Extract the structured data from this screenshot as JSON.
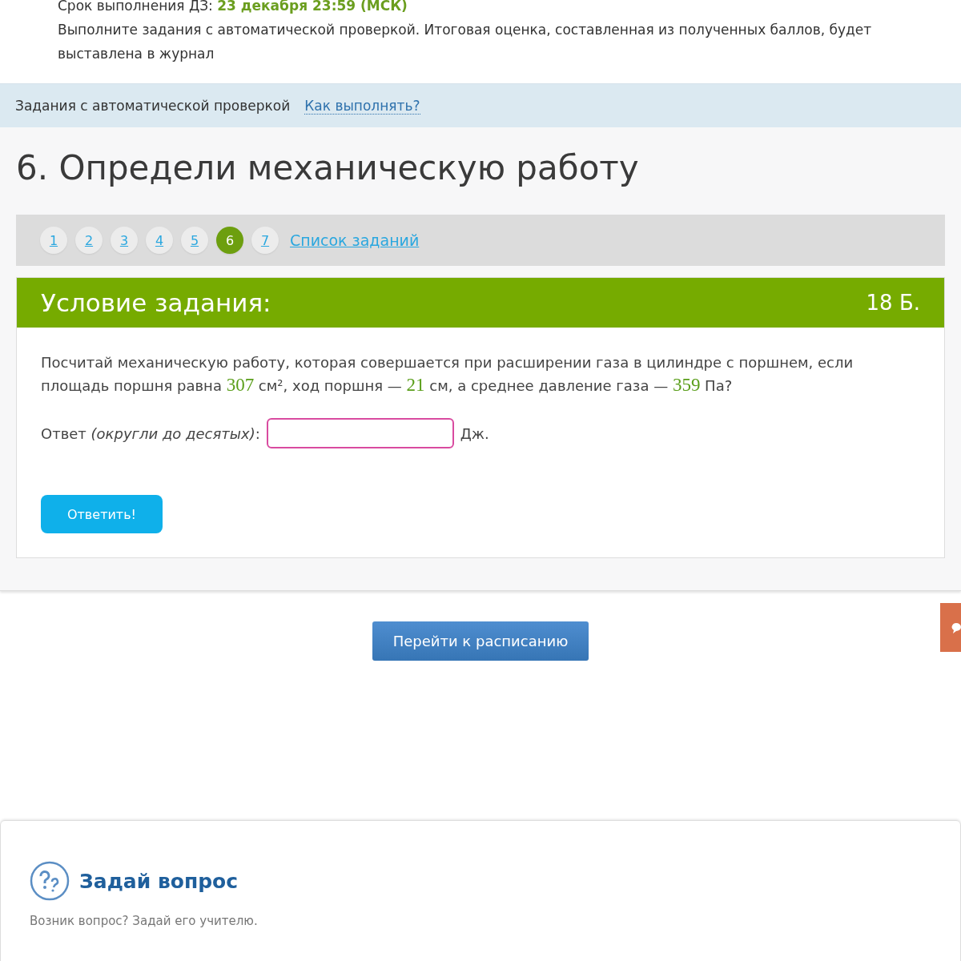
{
  "homework": {
    "deadline_label": "Срок выполнения ДЗ:",
    "deadline_value": "23 декабря 23:59 (МСК)",
    "description": "Выполните задания с автоматической проверкой. Итоговая оценка, составленная из полученных баллов, будет выставлена в журнал"
  },
  "section_bar": {
    "title": "Задания с автоматической проверкой",
    "help_link": "Как выполнять?"
  },
  "task_title": "6. Определи механическую работу",
  "task_nav": {
    "items": [
      {
        "label": "1",
        "selected": false
      },
      {
        "label": "2",
        "selected": false
      },
      {
        "label": "3",
        "selected": false
      },
      {
        "label": "4",
        "selected": false
      },
      {
        "label": "5",
        "selected": false
      },
      {
        "label": "6",
        "selected": true
      },
      {
        "label": "7",
        "selected": false
      }
    ],
    "list_link": "Список заданий"
  },
  "task": {
    "header": "Условие задания:",
    "points": "18 Б.",
    "question": [
      {
        "kind": "plain",
        "text": "Посчитай механическую работу, которая совершается при расширении газа в цилиндре с поршнем, если площадь поршня равна "
      },
      {
        "kind": "value",
        "text": "307"
      },
      {
        "kind": "plain",
        "text": " см², ход поршня — "
      },
      {
        "kind": "value",
        "text": "21"
      },
      {
        "kind": "plain",
        "text": " см, а среднее давление газа — "
      },
      {
        "kind": "value",
        "text": "359"
      },
      {
        "kind": "plain",
        "text": " Па?"
      }
    ],
    "answer_label": "Ответ *(округли до десятых)*:",
    "answer_unit": "Дж.",
    "submit": "Ответить!"
  },
  "schedule_button": "Перейти к расписанию",
  "ask": {
    "title": "Задай вопрос",
    "text": "Возник вопрос? Задай его учителю."
  }
}
